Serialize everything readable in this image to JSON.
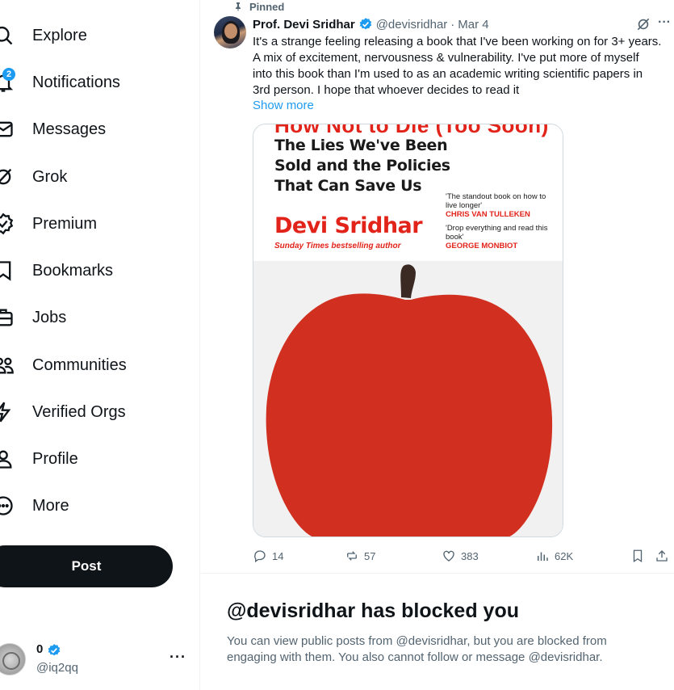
{
  "sidebar": {
    "items": [
      {
        "id": "explore",
        "label": "Explore",
        "icon": "search-icon"
      },
      {
        "id": "notifications",
        "label": "Notifications",
        "icon": "bell-icon",
        "badge": "2"
      },
      {
        "id": "messages",
        "label": "Messages",
        "icon": "envelope-icon"
      },
      {
        "id": "grok",
        "label": "Grok",
        "icon": "grok-icon"
      },
      {
        "id": "premium",
        "label": "Premium",
        "icon": "premium-badge-icon"
      },
      {
        "id": "bookmarks",
        "label": "Bookmarks",
        "icon": "bookmark-icon"
      },
      {
        "id": "jobs",
        "label": "Jobs",
        "icon": "briefcase-icon"
      },
      {
        "id": "communities",
        "label": "Communities",
        "icon": "people-icon"
      },
      {
        "id": "verified_orgs",
        "label": "Verified Orgs",
        "icon": "lightning-icon"
      },
      {
        "id": "profile",
        "label": "Profile",
        "icon": "person-icon"
      },
      {
        "id": "more",
        "label": "More",
        "icon": "more-circle-icon"
      }
    ],
    "post_label": "Post",
    "account": {
      "name": "0",
      "handle": "@iq2qq",
      "more": "···"
    }
  },
  "tweet": {
    "pinned_label": "Pinned",
    "author": "Prof. Devi Sridhar",
    "handle": "@devisridhar",
    "separator": "·",
    "date": "Mar 4",
    "more": "···",
    "text": "It's a strange feeling releasing a book that I've been working on for 3+ years.\nA mix of excitement, nervousness & vulnerability. I've put more of myself\ninto this book than I'm used to as an academic writing scientific papers in\n3rd person. I hope that whoever decides to read it",
    "show_more": "Show more",
    "cover": {
      "cut_title": "How Not to Die (Too Soon)",
      "subtitle": "The Lies We've Been\nSold and the Policies\nThat Can Save Us",
      "author": "Devi Sridhar",
      "author_sub": "Sunday Times bestselling author",
      "quote1": "'The standout book on how to live longer'",
      "quote1_attr": "CHRIS VAN TULLEKEN",
      "quote2": "'Drop everything and read this book'",
      "quote2_attr": "GEORGE MONBIOT",
      "accent_red": "#e2231a",
      "apple_red": "#d12f1f"
    },
    "actions": {
      "replies": "14",
      "reposts": "57",
      "likes": "383",
      "views": "62K"
    }
  },
  "blocked": {
    "title": "@devisridhar has blocked you",
    "description": "You can view public posts from @devisridhar, but you are blocked from engaging with them. You also cannot follow or message @devisridhar."
  },
  "colors": {
    "accent": "#1d9bf0",
    "text": "#0f1419",
    "secondary": "#536471"
  }
}
